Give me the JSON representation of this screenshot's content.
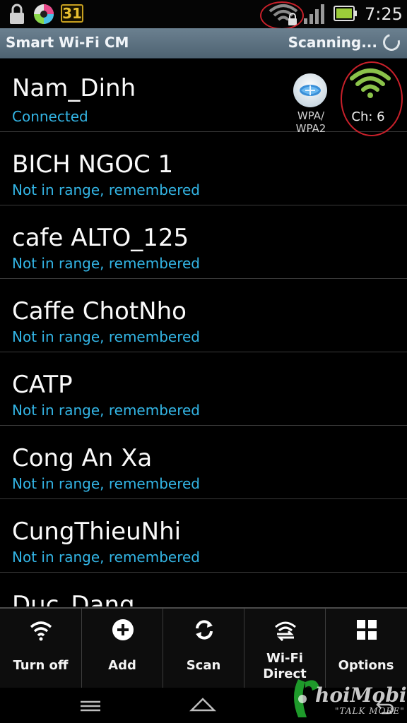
{
  "status_bar": {
    "calendar_day": "31",
    "time": "7:25",
    "icons": [
      "lock-icon",
      "media-disc-icon",
      "calendar-icon",
      "wifi-locked-icon",
      "cell-signal-icon",
      "battery-icon"
    ]
  },
  "header": {
    "title": "Smart Wi-Fi CM",
    "status": "Scanning..."
  },
  "networks": [
    {
      "ssid": "Nam_Dinh",
      "status": "Connected",
      "security": "WPA/\nWPA2",
      "channel": "Ch: 6"
    },
    {
      "ssid": "BICH NGOC 1",
      "status": "Not in range, remembered"
    },
    {
      "ssid": "cafe ALTO_125",
      "status": "Not in range, remembered"
    },
    {
      "ssid": "Caffe ChotNho",
      "status": "Not in range, remembered"
    },
    {
      "ssid": "CATP",
      "status": "Not in range, remembered"
    },
    {
      "ssid": "Cong An Xa",
      "status": "Not in range, remembered"
    },
    {
      "ssid": "CungThieuNhi",
      "status": "Not in range, remembered"
    },
    {
      "ssid": "Duc_Dang",
      "status": ""
    }
  ],
  "actions": [
    {
      "label": "Turn off",
      "icon": "wifi-icon"
    },
    {
      "label": "Add",
      "icon": "plus-circle-icon"
    },
    {
      "label": "Scan",
      "icon": "refresh-icon"
    },
    {
      "label": "Wi-Fi\nDirect",
      "icon": "wifi-direct-icon"
    },
    {
      "label": "Options",
      "icon": "grid-icon"
    }
  ],
  "watermark": {
    "brand": "hoiMobile",
    "slogan": "\"TALK MORE\""
  },
  "colors": {
    "accent_blue": "#33b5e5",
    "signal_green": "#8bc34a",
    "annotation_red": "#c8202a",
    "header_bg": "#5a6f7e"
  }
}
